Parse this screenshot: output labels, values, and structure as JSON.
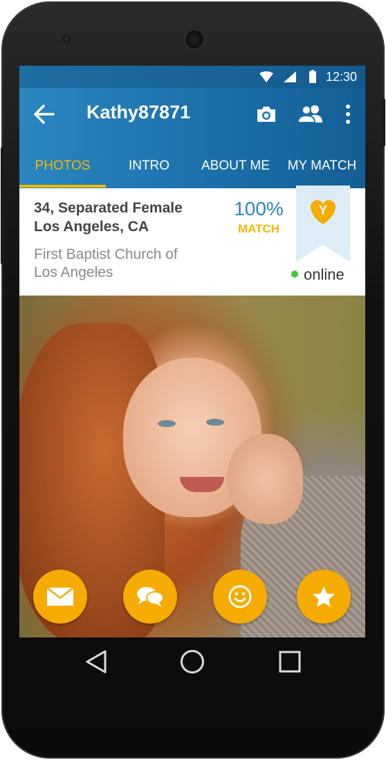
{
  "status_bar": {
    "time": "12:30"
  },
  "app_bar": {
    "title": "Kathy87871",
    "tabs": [
      {
        "label": "PHOTOS",
        "active": true
      },
      {
        "label": "INTRO",
        "active": false
      },
      {
        "label": "ABOUT ME",
        "active": false
      },
      {
        "label": "MY MATCH",
        "active": false
      }
    ]
  },
  "profile": {
    "age_status": "34, Separated Female",
    "location": "Los Angeles, CA",
    "church_line1": "First Baptist Church of",
    "church_line2": "Los Angeles",
    "match_percent": "100%",
    "match_label": "MATCH",
    "badge_letter": "Y",
    "online_status": "online"
  },
  "actions": [
    {
      "name": "message-button",
      "icon": "envelope-icon"
    },
    {
      "name": "chat-button",
      "icon": "chat-bubbles-icon"
    },
    {
      "name": "smile-button",
      "icon": "smiley-icon"
    },
    {
      "name": "favorite-button",
      "icon": "star-icon"
    }
  ],
  "colors": {
    "primary": "#2a86c0",
    "accent": "#f5b800",
    "fab": "#f5ab00",
    "online": "#3cc93c"
  }
}
